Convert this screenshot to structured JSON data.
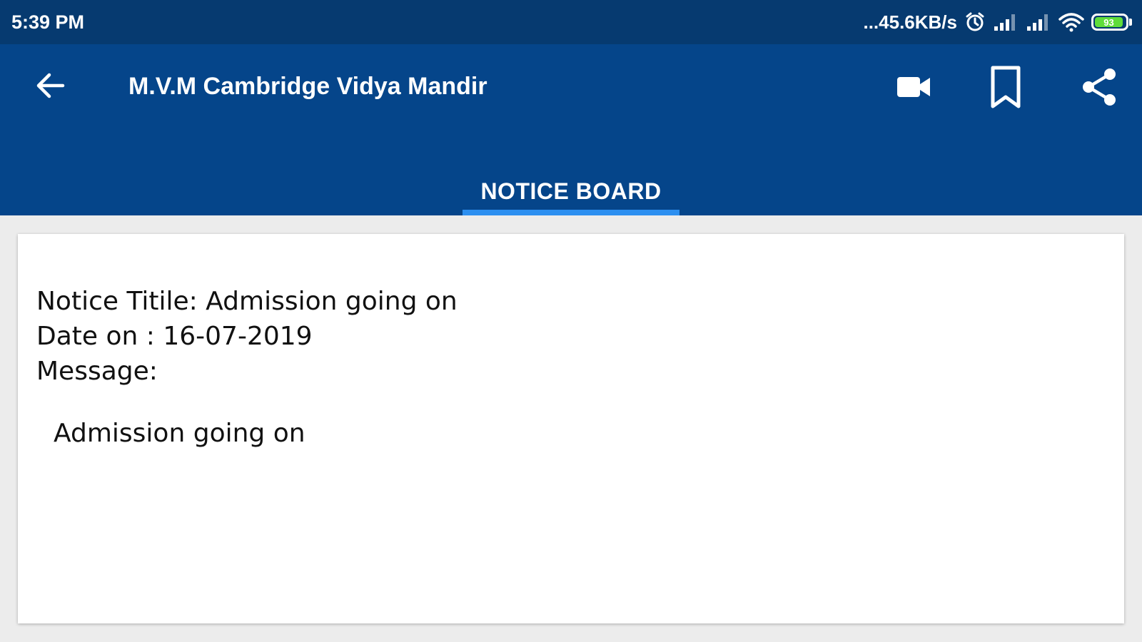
{
  "status_bar": {
    "time": "5:39 PM",
    "network_speed": "...45.6KB/s",
    "battery_level": "93",
    "icons": [
      "alarm-icon",
      "signal-icon",
      "signal-icon",
      "wifi-icon",
      "battery-icon"
    ]
  },
  "app_bar": {
    "title": "M.V.M Cambridge Vidya Mandir",
    "back_icon": "arrow-left-icon",
    "actions": [
      "video-camera-icon",
      "bookmark-icon",
      "share-icon"
    ]
  },
  "tabs": [
    {
      "label": "NOTICE BOARD",
      "selected": true
    }
  ],
  "notice": {
    "title_line": "Notice Titile: Admission going on",
    "date_line": "Date on : 16-07-2019",
    "message_label": "Message:",
    "message_body": "Admission going on"
  },
  "colors": {
    "status_bar": "#063a70",
    "app_bar": "#05458a",
    "tab_indicator": "#2c8ff0",
    "background": "#ececec",
    "card": "#ffffff",
    "battery_fill": "#5fdd3a"
  }
}
